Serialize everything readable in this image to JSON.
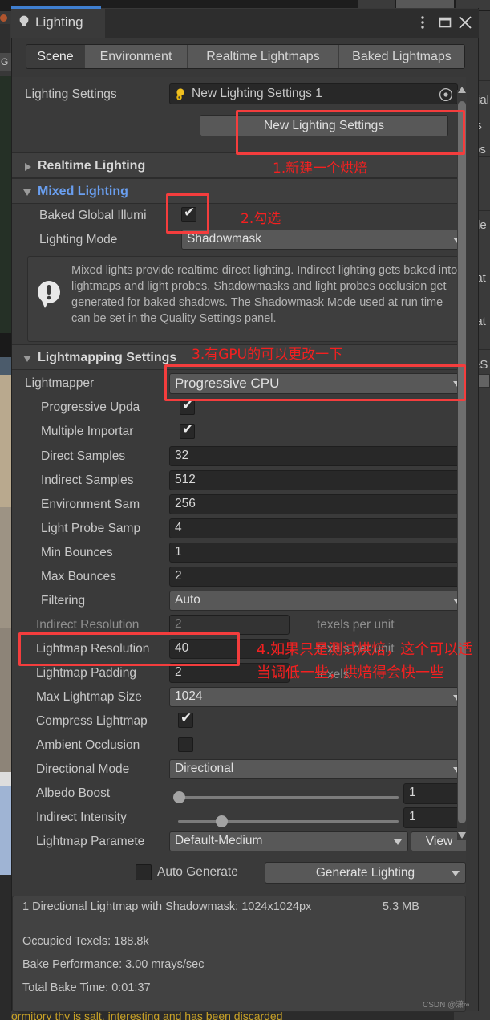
{
  "window": {
    "title": "Lighting",
    "icon": "lightbulb-icon",
    "controls": {
      "menu": "⋮",
      "maximize": "▢",
      "close": "✕"
    }
  },
  "tabs": [
    {
      "label": "Scene",
      "selected": true
    },
    {
      "label": "Environment",
      "selected": false
    },
    {
      "label": "Realtime Lightmaps",
      "selected": false
    },
    {
      "label": "Baked Lightmaps",
      "selected": false
    }
  ],
  "lighting_settings": {
    "label": "Lighting Settings",
    "asset_name": "New Lighting Settings 1",
    "picker_icon": "object-picker-icon",
    "new_button": "New Lighting Settings"
  },
  "sections": {
    "realtime": {
      "label": "Realtime Lighting",
      "expanded": false,
      "color": "#d8d8d8"
    },
    "mixed": {
      "label": "Mixed Lighting",
      "expanded": true,
      "color": "#6a9ff0"
    },
    "lightmapping": {
      "label": "Lightmapping Settings",
      "expanded": true,
      "color": "#d8d8d8"
    }
  },
  "mixed_lighting": {
    "baked_gi": {
      "label": "Baked Global Illumi",
      "checked": true
    },
    "lighting_mode": {
      "label": "Lighting Mode",
      "value": "Shadowmask"
    },
    "help": "Mixed lights provide realtime direct lighting. Indirect lighting gets baked into lightmaps and light probes. Shadowmasks and light probes occlusion get generated for baked shadows. The Shadowmask Mode used at run time can be set in the Quality Settings panel."
  },
  "lightmapping": {
    "lightmapper": {
      "label": "Lightmapper",
      "value": "Progressive CPU"
    },
    "progressive_updates": {
      "label": "Progressive Upda",
      "checked": true
    },
    "multiple_importance": {
      "label": "Multiple Importar",
      "checked": true
    },
    "direct_samples": {
      "label": "Direct Samples",
      "value": "32"
    },
    "indirect_samples": {
      "label": "Indirect Samples",
      "value": "512"
    },
    "environment_samples": {
      "label": "Environment Sam",
      "value": "256"
    },
    "light_probe_samples": {
      "label": "Light Probe Samp",
      "value": "4"
    },
    "min_bounces": {
      "label": "Min Bounces",
      "value": "1"
    },
    "max_bounces": {
      "label": "Max Bounces",
      "value": "2"
    },
    "filtering": {
      "label": "Filtering",
      "value": "Auto"
    },
    "indirect_resolution": {
      "label": "Indirect Resolution",
      "value": "2",
      "unit": "texels per unit"
    },
    "lightmap_resolution": {
      "label": "Lightmap Resolution",
      "value": "40",
      "unit": "texels per unit"
    },
    "lightmap_padding": {
      "label": "Lightmap Padding",
      "value": "2",
      "unit": "texels"
    },
    "max_lightmap_size": {
      "label": "Max Lightmap Size",
      "value": "1024"
    },
    "compress_lightmaps": {
      "label": "Compress Lightmap",
      "checked": true
    },
    "ambient_occlusion": {
      "label": "Ambient Occlusion",
      "checked": false
    },
    "directional_mode": {
      "label": "Directional Mode",
      "value": "Directional"
    },
    "albedo_boost": {
      "label": "Albedo Boost",
      "value": "1",
      "slider_pct": 0
    },
    "indirect_intensity": {
      "label": "Indirect Intensity",
      "value": "1",
      "slider_pct": 19
    },
    "lightmap_parameters": {
      "label": "Lightmap Paramete",
      "value": "Default-Medium",
      "view_button": "View"
    }
  },
  "generate": {
    "auto_generate": {
      "label": "Auto Generate",
      "checked": false
    },
    "button": "Generate Lighting"
  },
  "stats": {
    "lightmap_line": "1 Directional Lightmap with Shadowmask: 1024x1024px",
    "size": "5.3 MB",
    "occupied_texels": "Occupied Texels: 188.8k",
    "bake_performance": "Bake Performance: 3.00 mrays/sec",
    "total_bake_time": "Total Bake Time: 0:01:37"
  },
  "annotations": [
    {
      "id": "a1",
      "text": "1.新建一个烘焙"
    },
    {
      "id": "a2",
      "text": "2.勾选"
    },
    {
      "id": "a3",
      "text": "3.有GPU的可以更改一下"
    },
    {
      "id": "a4_line1",
      "text": "4.如果只是测试烘焙，这个可以适"
    },
    {
      "id": "a4_line2",
      "text": "当调低一些，烘焙得会快一些"
    }
  ],
  "background": {
    "right_labels": [
      "rial",
      "ls",
      "os",
      "de",
      "lat",
      "lat",
      "s",
      "eS"
    ],
    "bottom_text": "ormitory thy is salt, interesting and has been discarded",
    "g_tag": "G"
  },
  "watermark": "CSDN @潇∞",
  "colors": {
    "accent_blue": "#3f7fd0",
    "section_blue": "#6a9ff0",
    "annotation_red": "#f42020",
    "panel_bg": "#3a3a3a",
    "field_bg": "#282828",
    "dropdown_bg": "#585858"
  }
}
